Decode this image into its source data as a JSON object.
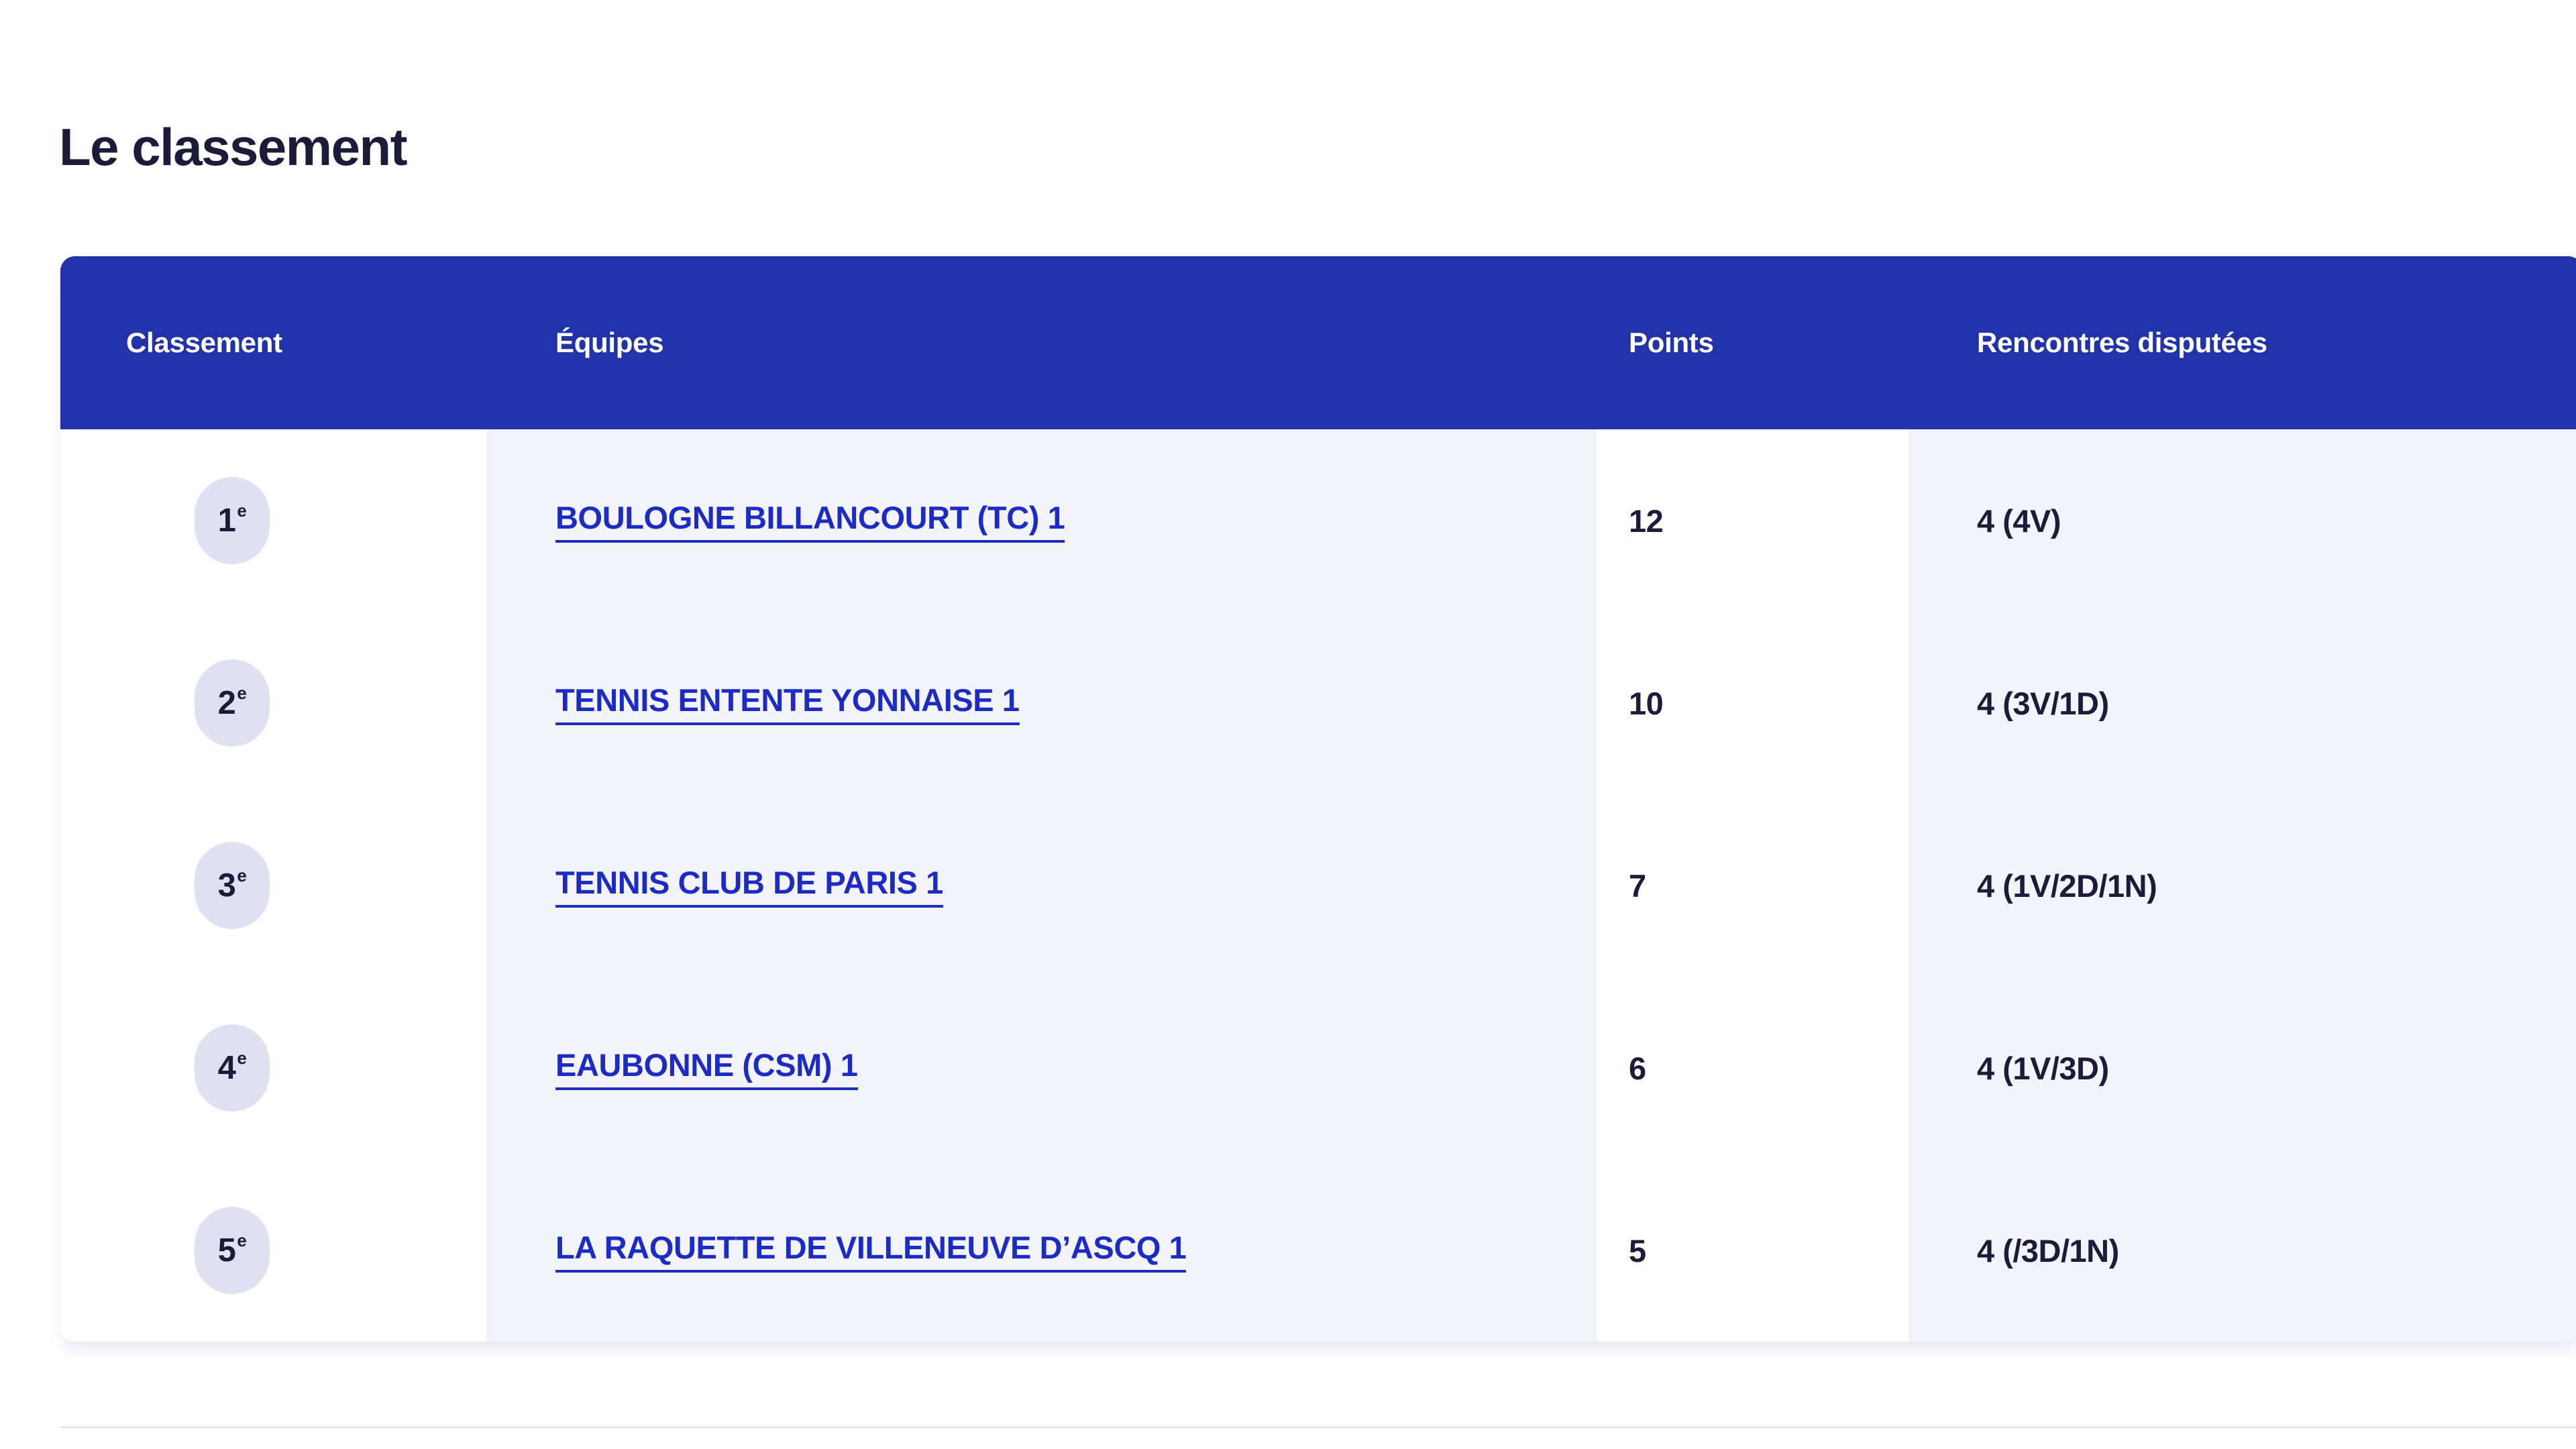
{
  "page": {
    "title": "Le classement",
    "title_color": "#1b1b3a",
    "background": "#ffffff"
  },
  "theme": {
    "header_bg": "#2232ab",
    "header_text": "#ffffff",
    "tint_column_bg": "#f3f4f9",
    "plain_column_bg": "#ffffff",
    "badge_bg": "#dfe0f2",
    "badge_text": "#1b1b3a",
    "link_color": "#1d2bc6",
    "value_color": "#1b1b3a",
    "divider_color": "#e6e6ea"
  },
  "table": {
    "columns": [
      {
        "key": "rank",
        "label": "Classement"
      },
      {
        "key": "team",
        "label": "Équipes"
      },
      {
        "key": "points",
        "label": "Points"
      },
      {
        "key": "played",
        "label": "Rencontres disputées"
      }
    ],
    "rows": [
      {
        "rank_number": "1",
        "rank_suffix": "e",
        "team": "BOULOGNE BILLANCOURT (TC) 1",
        "points": "12",
        "played": "4 (4V)"
      },
      {
        "rank_number": "2",
        "rank_suffix": "e",
        "team": "TENNIS ENTENTE YONNAISE 1",
        "points": "10",
        "played": "4 (3V/1D)"
      },
      {
        "rank_number": "3",
        "rank_suffix": "e",
        "team": "TENNIS CLUB DE PARIS 1",
        "points": "7",
        "played": "4 (1V/2D/1N)"
      },
      {
        "rank_number": "4",
        "rank_suffix": "e",
        "team": "EAUBONNE (CSM) 1",
        "points": "6",
        "played": "4 (1V/3D)"
      },
      {
        "rank_number": "5",
        "rank_suffix": "e",
        "team": "LA RAQUETTE DE VILLENEUVE D’ASCQ 1",
        "points": "5",
        "played": "4 (/3D/1N)"
      }
    ]
  }
}
